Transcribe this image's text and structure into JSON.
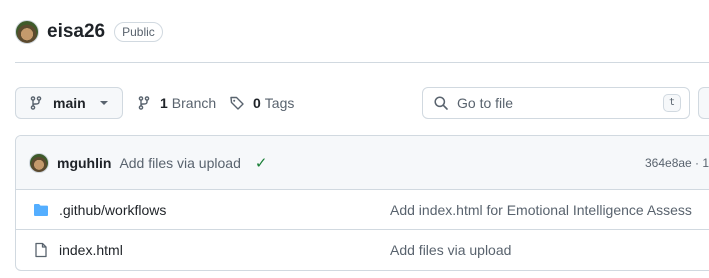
{
  "repo": {
    "name": "eisa26",
    "visibility": "Public"
  },
  "toolbar": {
    "branch": "main",
    "branch_count": "1",
    "branch_label": "Branch",
    "tag_count": "0",
    "tag_label": "Tags",
    "goto_placeholder": "Go to file",
    "goto_shortcut": "t"
  },
  "latest_commit": {
    "author": "mguhlin",
    "message": "Add files via upload",
    "hash": "364e8ae · 1"
  },
  "files": [
    {
      "type": "folder",
      "name": ".github/workflows",
      "commit": "Add index.html for Emotional Intelligence Assess"
    },
    {
      "type": "file",
      "name": "index.html",
      "commit": "Add files via upload"
    }
  ],
  "colors": {
    "folder": "#54aeff",
    "success": "#1a7f37",
    "muted": "#59636e",
    "border": "#d1d9e0"
  }
}
